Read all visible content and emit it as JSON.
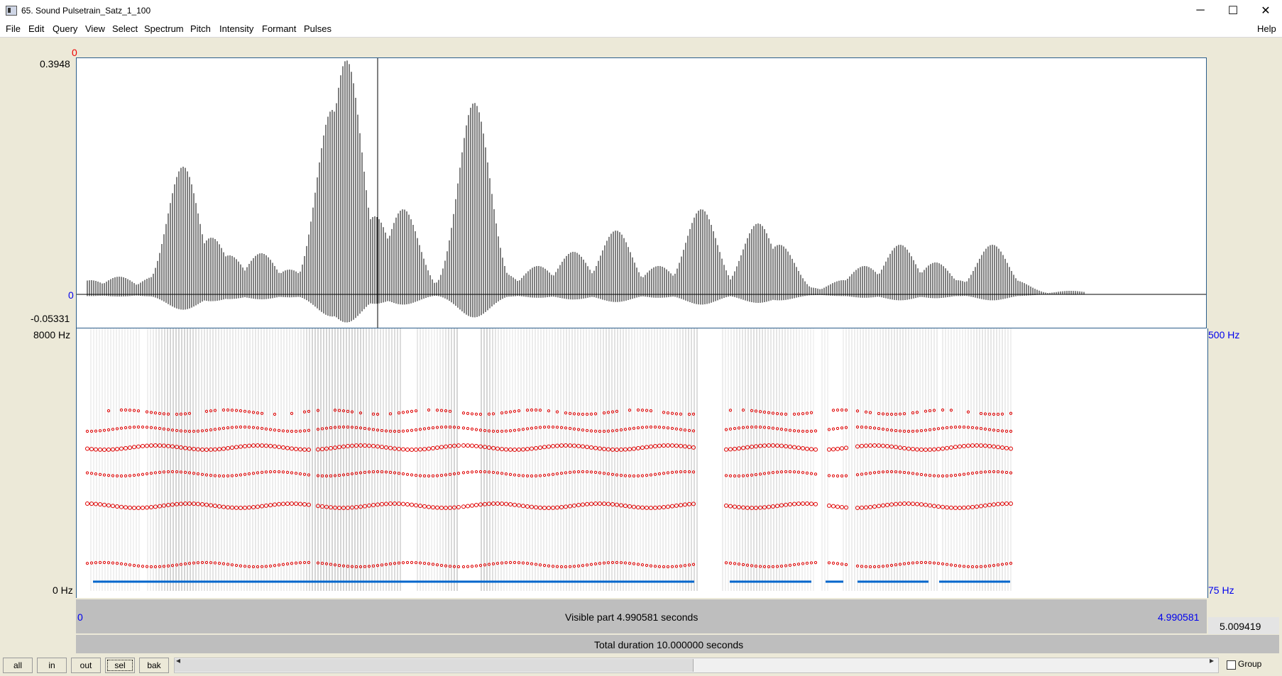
{
  "window": {
    "title": "65. Sound Pulsetrain_Satz_1_100",
    "minimize_glyph": "─",
    "maximize_glyph": "☐",
    "close_glyph": "✕"
  },
  "menu": {
    "items": [
      "File",
      "Edit",
      "Query",
      "View",
      "Select",
      "Spectrum",
      "Pitch",
      "Intensity",
      "Formant",
      "Pulses"
    ],
    "help": "Help"
  },
  "waveform": {
    "cursor_top": "0",
    "y_max": "0.3948",
    "y_zero": "0",
    "y_min": "-0.05331"
  },
  "spectrogram": {
    "freq_top_left": "8000 Hz",
    "freq_bottom_left": "0 Hz",
    "pitch_top_right": "500 Hz",
    "pitch_bottom_right": "75 Hz"
  },
  "time_bar": {
    "start": "0",
    "visible_part": "Visible part 4.990581 seconds",
    "end": "4.990581",
    "remaining": "5.009419",
    "total": "Total duration 10.000000 seconds"
  },
  "bottom": {
    "buttons": [
      "all",
      "in",
      "out",
      "sel",
      "bak"
    ],
    "group_label": "Group",
    "group_checked": false,
    "scroll_left": "◂",
    "scroll_right": "▸"
  },
  "colors": {
    "waveform": "#000000",
    "formant": "#e00000",
    "pitch": "#0066cc",
    "frame": "#2b5d8a",
    "axis_blue": "#0000ee",
    "axis_red": "#ee0000"
  }
}
